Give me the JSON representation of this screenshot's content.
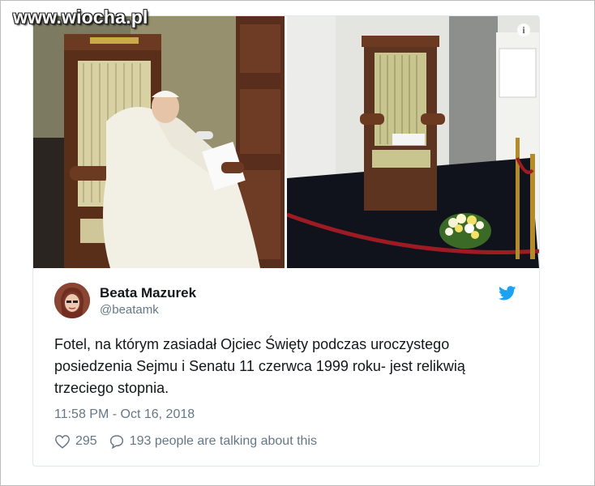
{
  "watermark": {
    "text": "www.wiocha.pl"
  },
  "tweet": {
    "author_name": "Beata Mazurek",
    "author_handle": "@beatamk",
    "text": "Fotel, na którym zasiadał Ojciec Święty podczas uroczystego posiedzenia Sejmu i Senatu 11 czerwca 1999 roku- jest relikwią trzeciego stopnia.",
    "timestamp": "11:58 PM - Oct 16, 2018",
    "likes": "295",
    "conversation": "193 people are talking about this",
    "info_icon_glyph": "i"
  },
  "colors": {
    "twitter_blue": "#1da1f2",
    "text_dark": "#14171a",
    "text_muted": "#657786",
    "border": "#e1e8ed"
  },
  "icons": [
    "info-icon",
    "twitter-bird-icon",
    "heart-icon",
    "reply-bubble-icon"
  ]
}
